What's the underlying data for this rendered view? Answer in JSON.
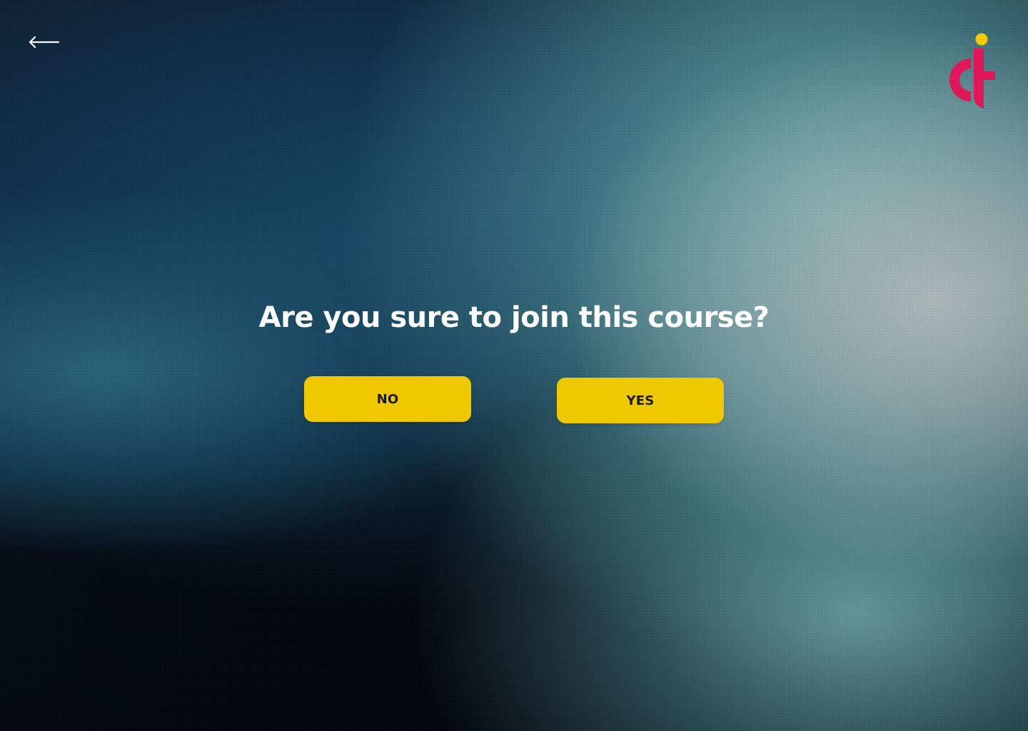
{
  "header": {
    "back_icon": "arrow-left-icon",
    "logo_icon": "ct-logo-icon",
    "logo_colors": {
      "letters": "#e0185a",
      "dot": "#f5c800"
    }
  },
  "dialog": {
    "question": "Are you sure to join this course?",
    "no_label": "NO",
    "yes_label": "YES"
  },
  "colors": {
    "button_bg": "#efc800",
    "button_text": "#1a1a1a",
    "question_text": "#ffffff"
  }
}
